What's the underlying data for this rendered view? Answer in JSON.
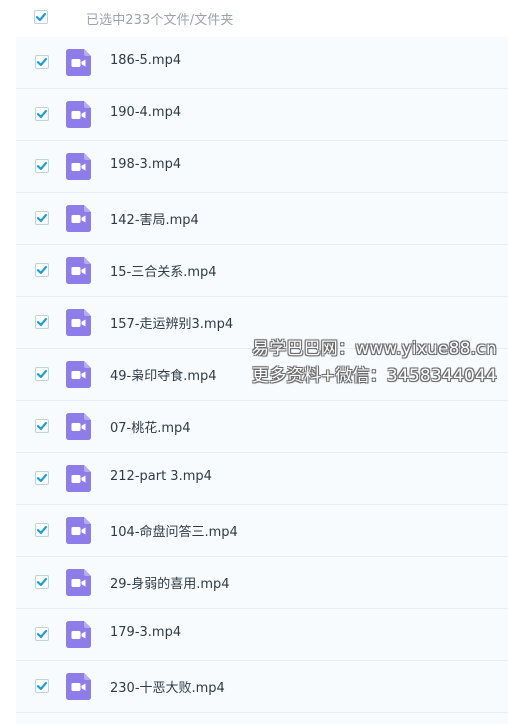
{
  "colors": {
    "checkbox_check": "#1aa0d8",
    "video_icon": "#8e7de8",
    "row_bg": "#f7fbfe",
    "text": "#2f3a45",
    "header_text": "#9aa3ad"
  },
  "header": {
    "select_all_checked": true,
    "selected_text": "已选中233个文件/文件夹"
  },
  "files": [
    {
      "name": "186-5.mp4",
      "icon": "video-file-icon",
      "checked": true
    },
    {
      "name": "190-4.mp4",
      "icon": "video-file-icon",
      "checked": true
    },
    {
      "name": "198-3.mp4",
      "icon": "video-file-icon",
      "checked": true
    },
    {
      "name": "142-害局.mp4",
      "icon": "video-file-icon",
      "checked": true
    },
    {
      "name": "15-三合关系.mp4",
      "icon": "video-file-icon",
      "checked": true
    },
    {
      "name": "157-走运辨别3.mp4",
      "icon": "video-file-icon",
      "checked": true
    },
    {
      "name": "49-枭印夺食.mp4",
      "icon": "video-file-icon",
      "checked": true
    },
    {
      "name": "07-桃花.mp4",
      "icon": "video-file-icon",
      "checked": true
    },
    {
      "name": "212-part 3.mp4",
      "icon": "video-file-icon",
      "checked": true
    },
    {
      "name": "104-命盘问答三.mp4",
      "icon": "video-file-icon",
      "checked": true
    },
    {
      "name": "29-身弱的喜用.mp4",
      "icon": "video-file-icon",
      "checked": true
    },
    {
      "name": "179-3.mp4",
      "icon": "video-file-icon",
      "checked": true
    },
    {
      "name": "230-十恶大败.mp4",
      "icon": "video-file-icon",
      "checked": true
    }
  ],
  "watermark": {
    "line1": "易学巴巴网：www.yixue88.cn",
    "line2": "更多资料+微信：3458344044"
  }
}
